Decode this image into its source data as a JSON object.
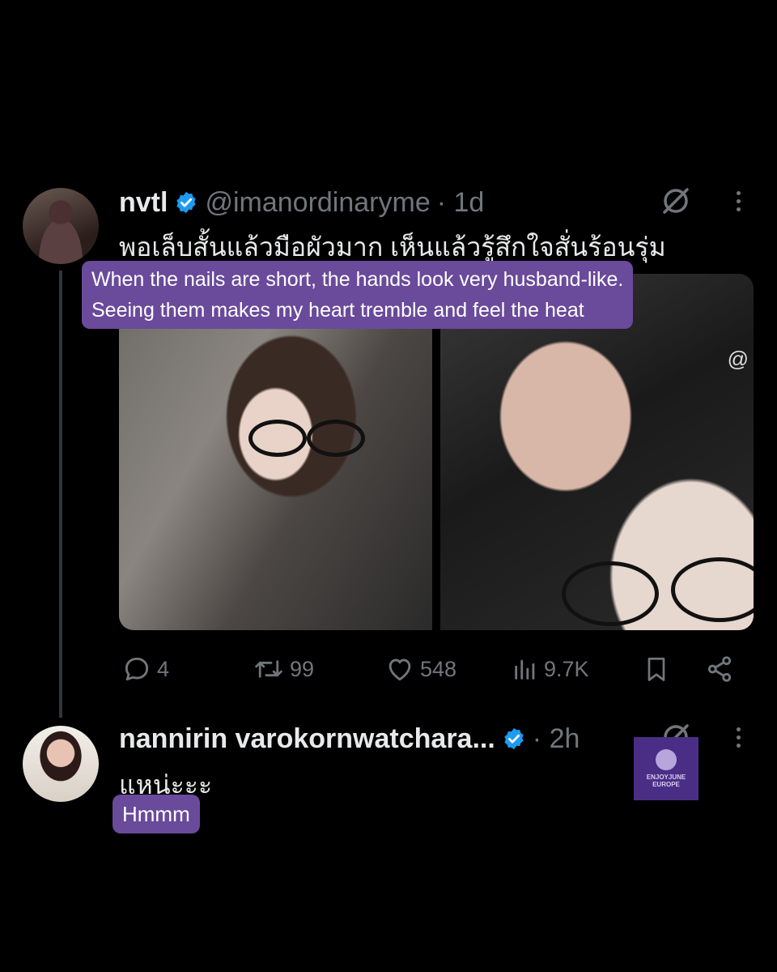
{
  "post": {
    "name": "nvtl",
    "handle": "@imanordinaryme",
    "time": "· 1d",
    "text": "พอเล็บสั้นแล้วมือผัวมาก เห็นแล้วรู้สึกใจสั่นร้อนรุ่ม",
    "translation_line1": "When the nails are short, the hands look very husband-like.",
    "translation_line2": "Seeing them makes my heart tremble and feel the heat",
    "photo2_overlay": "@",
    "replies": "4",
    "reposts": "99",
    "likes": "548",
    "views": "9.7K"
  },
  "reply": {
    "name": "nannirin varokornwatchara...",
    "time": "· 2h",
    "text": "แหน่ะะะ",
    "translation": "Hmmm"
  },
  "watermark": {
    "line1": "ENJOYJUNE",
    "line2": "EUROPE"
  },
  "colors": {
    "background": "#000000",
    "verified": "#1d9bf0",
    "translation_bg": "#6a4a9a",
    "muted": "#71767b"
  }
}
